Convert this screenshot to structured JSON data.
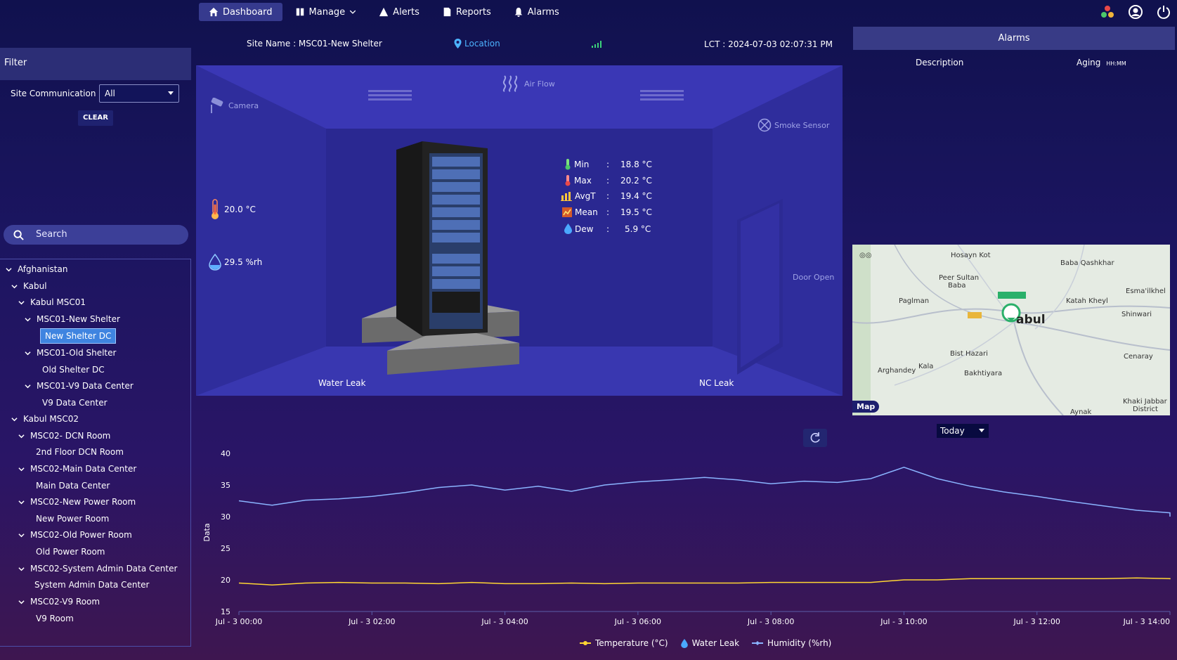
{
  "nav": {
    "dashboard": "Dashboard",
    "manage": "Manage",
    "alerts": "Alerts",
    "reports": "Reports",
    "alarms": "Alarms"
  },
  "filter": {
    "title": "Filter",
    "site_comm_label": "Site Communication",
    "site_comm_value": "All",
    "clear": "CLEAR",
    "search_placeholder": "Search"
  },
  "tree": [
    {
      "label": "Afghanistan"
    },
    {
      "label": "Kabul"
    },
    {
      "label": "Kabul MSC01"
    },
    {
      "label": "MSC01-New Shelter"
    },
    {
      "label": "New Shelter DC"
    },
    {
      "label": "MSC01-Old Shelter"
    },
    {
      "label": "Old Shelter DC"
    },
    {
      "label": "MSC01-V9 Data Center"
    },
    {
      "label": "V9 Data Center"
    },
    {
      "label": "Kabul MSC02"
    },
    {
      "label": "MSC02- DCN Room"
    },
    {
      "label": "2nd Floor DCN Room"
    },
    {
      "label": "MSC02-Main Data Center"
    },
    {
      "label": "Main Data Center"
    },
    {
      "label": "MSC02-New Power Room"
    },
    {
      "label": "New Power Room"
    },
    {
      "label": "MSC02-Old Power Room"
    },
    {
      "label": "Old Power Room"
    },
    {
      "label": "MSC02-System Admin Data Center"
    },
    {
      "label": "System Admin Data Center"
    },
    {
      "label": "MSC02-V9 Room"
    },
    {
      "label": "V9 Room"
    }
  ],
  "site": {
    "name": "Site Name : MSC01-New Shelter",
    "location": "Location",
    "lct": "LCT : 2024-07-03 02:07:31 PM"
  },
  "room": {
    "airflow": "Air Flow",
    "camera": "Camera",
    "smoke": "Smoke Sensor",
    "door": "Door Open",
    "temperature": "20.0 °C",
    "humidity": "29.5 %rh",
    "water_leak": "Water Leak",
    "nc_leak": "NC Leak"
  },
  "stats": [
    {
      "label": "Min",
      "value": "18.8 °C"
    },
    {
      "label": "Max",
      "value": "20.2 °C"
    },
    {
      "label": "AvgT",
      "value": "19.4 °C"
    },
    {
      "label": "Mean",
      "value": "19.5 °C"
    },
    {
      "label": "Dew",
      "value": "5.9 °C"
    }
  ],
  "alarms": {
    "title": "Alarms",
    "col_description": "Description",
    "col_aging": "Aging",
    "col_aging_unit": "HH:MM"
  },
  "map": {
    "button": "Map",
    "labels": [
      "Hosayn Kot",
      "Baba Qashkhar",
      "Peer Sultan",
      "Baba",
      "Paglman",
      "Katah Kheyl",
      "Esma'ilkhel",
      "Shinwari",
      "abul",
      "Bist Hazari",
      "Kala",
      "Arghandey",
      "Bakhtiyara",
      "Cenaray",
      "Khaki Jabbar",
      "District",
      "Aynak"
    ]
  },
  "range_select": "Today",
  "chart_data": {
    "type": "line",
    "ylabel": "Data",
    "ylim": [
      15,
      40
    ],
    "yticks": [
      15,
      20,
      25,
      30,
      35,
      40
    ],
    "xticks": [
      "Jul - 3 00:00",
      "Jul - 3 02:00",
      "Jul - 3 04:00",
      "Jul - 3 06:00",
      "Jul - 3 08:00",
      "Jul - 3 10:00",
      "Jul - 3 12:00",
      "Jul - 3 14:00"
    ],
    "x_hours": [
      0,
      0.5,
      1,
      1.5,
      2,
      2.5,
      3,
      3.5,
      4,
      4.5,
      5,
      5.5,
      6,
      6.5,
      7,
      7.5,
      8,
      8.5,
      9,
      9.5,
      10,
      10.5,
      11,
      11.5,
      12,
      12.5,
      13,
      13.5,
      14,
      14.2
    ],
    "series": [
      {
        "name": "Temperature (°C)",
        "color": "#ffd633",
        "values": [
          19.5,
          19.2,
          19.5,
          19.6,
          19.5,
          19.5,
          19.4,
          19.6,
          19.4,
          19.4,
          19.5,
          19.4,
          19.5,
          19.5,
          19.5,
          19.5,
          19.6,
          19.6,
          19.6,
          19.6,
          20.0,
          20.0,
          20.2,
          20.2,
          20.2,
          20.2,
          20.2,
          20.3,
          20.2,
          20.1
        ]
      },
      {
        "name": "Water Leak",
        "color": "#4aa8ff",
        "values": []
      },
      {
        "name": "Humidity (%rh)",
        "color": "#8ab4ff",
        "values": [
          32.5,
          31.8,
          32.6,
          32.8,
          33.2,
          33.8,
          34.6,
          35.0,
          34.2,
          34.8,
          34.0,
          35.0,
          35.5,
          35.8,
          36.2,
          35.8,
          35.2,
          35.6,
          35.4,
          36.0,
          37.8,
          36.0,
          34.8,
          33.9,
          33.2,
          32.4,
          31.7,
          31.0,
          30.6,
          30.0
        ]
      }
    ],
    "legend_position": "bottom-center"
  }
}
